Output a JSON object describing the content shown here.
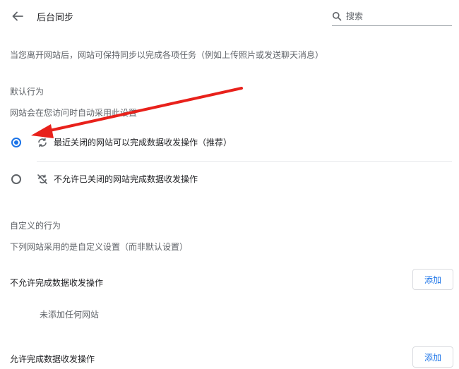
{
  "header": {
    "title": "后台同步",
    "search_placeholder": "搜索"
  },
  "description": "当您离开网站后，网站可保持同步以完成各项任务（例如上传照片或发送聊天消息）",
  "default_behavior": {
    "heading": "默认行为",
    "subtext": "网站会在您访问时自动采用此设置",
    "options": [
      {
        "label": "最近关闭的网站可以完成数据收发操作（推荐）",
        "icon": "sync-icon",
        "selected": true
      },
      {
        "label": "不允许已关闭的网站完成数据收发操作",
        "icon": "sync-disabled-icon",
        "selected": false
      }
    ]
  },
  "custom_behavior": {
    "heading": "自定义的行为",
    "subtext": "下列网站采用的是自定义设置（而非默认设置）",
    "block_section": {
      "label": "不允许完成数据收发操作",
      "add_label": "添加",
      "empty_text": "未添加任何网站"
    },
    "allow_section": {
      "label": "允许完成数据收发操作",
      "add_label": "添加"
    }
  },
  "colors": {
    "accent": "#1a73e8",
    "annotation_arrow": "#e8211b"
  }
}
